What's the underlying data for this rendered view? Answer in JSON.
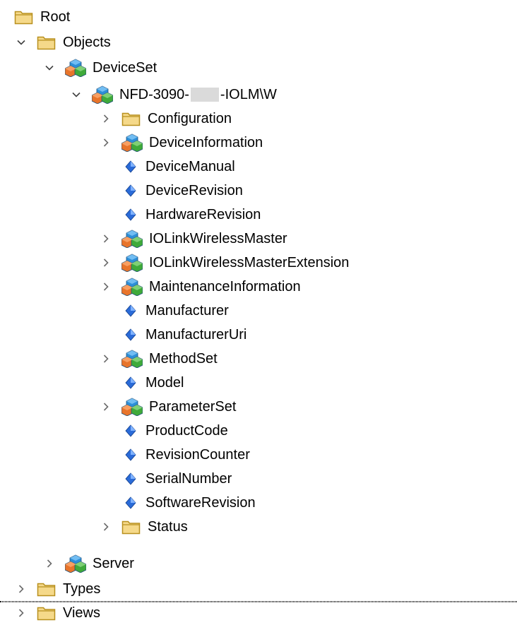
{
  "tree": {
    "root": {
      "label": "Root",
      "icon": "folder-icon"
    },
    "objects": {
      "label": "Objects",
      "icon": "folder-icon"
    },
    "device_set": {
      "label": "DeviceSet",
      "icon": "object-icon"
    },
    "device": {
      "label_prefix": "NFD-3090-",
      "label_suffix": "-IOLM\\W",
      "icon": "object-icon"
    },
    "device_children": [
      {
        "label": "Configuration",
        "type": "folder",
        "expandable": true
      },
      {
        "label": "DeviceInformation",
        "type": "object",
        "expandable": true
      },
      {
        "label": "DeviceManual",
        "type": "variable",
        "expandable": false
      },
      {
        "label": "DeviceRevision",
        "type": "variable",
        "expandable": false
      },
      {
        "label": "HardwareRevision",
        "type": "variable",
        "expandable": false
      },
      {
        "label": "IOLinkWirelessMaster",
        "type": "object",
        "expandable": true
      },
      {
        "label": "IOLinkWirelessMasterExtension",
        "type": "object",
        "expandable": true
      },
      {
        "label": "MaintenanceInformation",
        "type": "object",
        "expandable": true
      },
      {
        "label": "Manufacturer",
        "type": "variable",
        "expandable": false
      },
      {
        "label": "ManufacturerUri",
        "type": "variable",
        "expandable": false
      },
      {
        "label": "MethodSet",
        "type": "object",
        "expandable": true
      },
      {
        "label": "Model",
        "type": "variable",
        "expandable": false
      },
      {
        "label": "ParameterSet",
        "type": "object",
        "expandable": true
      },
      {
        "label": "ProductCode",
        "type": "variable",
        "expandable": false
      },
      {
        "label": "RevisionCounter",
        "type": "variable",
        "expandable": false
      },
      {
        "label": "SerialNumber",
        "type": "variable",
        "expandable": false
      },
      {
        "label": "SoftwareRevision",
        "type": "variable",
        "expandable": false
      },
      {
        "label": "Status",
        "type": "folder",
        "expandable": true
      }
    ],
    "server": {
      "label": "Server",
      "icon": "object-icon"
    },
    "types": {
      "label": "Types",
      "icon": "folder-icon"
    },
    "views": {
      "label": "Views",
      "icon": "folder-icon"
    }
  },
  "colors": {
    "folder_fill": "#f5d98a",
    "folder_stroke": "#b8901e",
    "cube_orange": "#e8742a",
    "cube_green": "#3faa3a",
    "cube_blue": "#2d8fd8",
    "variable_blue": "#2a6bd8",
    "chevron": "#6b6b6b"
  }
}
